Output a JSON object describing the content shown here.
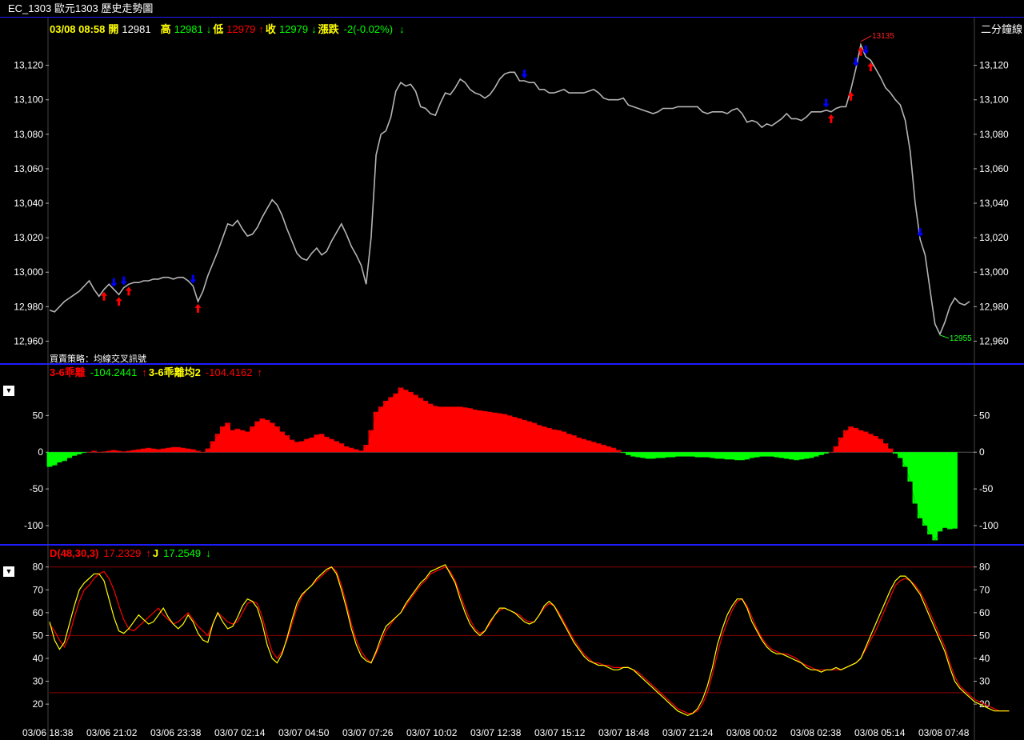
{
  "window": {
    "title": "EC_1303 歐元1303  歷史走勢圖"
  },
  "price_header": {
    "datetime": "03/08 08:58",
    "open_label": "開",
    "open": "12981",
    "high_label": "高",
    "high": "12981",
    "high_arrow": "↓",
    "low_label": "低",
    "low": "12979",
    "low_arrow": "↑",
    "close_label": "收",
    "close": "12979",
    "close_arrow": "↓",
    "change_label": "漲跌",
    "change": "-2(-0.02%)",
    "change_arrow": "↓",
    "period": "二分鐘線"
  },
  "strategy_label": "買賣策略：均線交叉訊號",
  "bias_header": {
    "name1": "3-6乖離",
    "value1": "-104.2441",
    "arrow1": "↑",
    "name2": "3-6乖離均2",
    "value2": "-104.4162",
    "arrow2": "↑"
  },
  "kd_header": {
    "name1": "D(48,30,3)",
    "value1": "17.2329",
    "arrow1": "↑",
    "name2": "J",
    "value2": "17.2549",
    "arrow2": "↓"
  },
  "panel_button": "▼",
  "colors": {
    "price_line": "#b4b4b4",
    "up": "#ff0000",
    "down": "#00ff00",
    "buy": "#ff0000",
    "sell": "#0000ff",
    "d_line": "#ff0000",
    "j_line": "#ffff00",
    "border": "#1c1cff",
    "label": "#ffff00"
  },
  "chart_data": [
    {
      "type": "line",
      "panel": "price",
      "ylim": [
        12950,
        13137
      ],
      "yticks": [
        12960,
        12980,
        13000,
        13020,
        13040,
        13060,
        13080,
        13100,
        13120
      ],
      "ytick_labels": [
        "12,960",
        "12,980",
        "13,000",
        "13,020",
        "13,040",
        "13,060",
        "13,080",
        "13,100",
        "13,120"
      ],
      "xlabels": [
        "03/06 18:38",
        "03/06 21:02",
        "03/06 23:38",
        "03/07 02:14",
        "03/07 04:50",
        "03/07 07:26",
        "03/07 10:02",
        "03/07 12:38",
        "03/07 15:12",
        "03/07 18:48",
        "03/07 21:24",
        "03/08 00:02",
        "03/08 02:38",
        "03/08 05:14",
        "03/08 07:48"
      ],
      "series": [
        {
          "values": [
            12978,
            12977,
            12980,
            12983,
            12985,
            12987,
            12989,
            12992,
            12995,
            12990,
            12986,
            12990,
            12993,
            12990,
            12987,
            12991,
            12993,
            12994,
            12994,
            12995,
            12995,
            12996,
            12996,
            12997,
            12997,
            12996,
            12997,
            12997,
            12995,
            12992,
            12983,
            12989,
            12998,
            13005,
            13012,
            13020,
            13028,
            13027,
            13030,
            13025,
            13021,
            13022,
            13026,
            13032,
            13037,
            13042,
            13039,
            13033,
            13025,
            13018,
            13011,
            13008,
            13007,
            13011,
            13014,
            13010,
            13012,
            13018,
            13023,
            13028,
            13022,
            13015,
            13010,
            13004,
            12993,
            13020,
            13068,
            13080,
            13082,
            13090,
            13105,
            13110,
            13108,
            13109,
            13105,
            13096,
            13095,
            13092,
            13091,
            13098,
            13104,
            13103,
            13107,
            13112,
            13110,
            13106,
            13104,
            13103,
            13101,
            13103,
            13107,
            13112,
            13115,
            13116,
            13116,
            13111,
            13111,
            13110,
            13110,
            13106,
            13106,
            13104,
            13104,
            13105,
            13106,
            13104,
            13104,
            13104,
            13104,
            13105,
            13106,
            13104,
            13101,
            13100,
            13100,
            13100,
            13101,
            13097,
            13096,
            13095,
            13094,
            13093,
            13092,
            13093,
            13095,
            13095,
            13095,
            13096,
            13096,
            13096,
            13096,
            13096,
            13093,
            13092,
            13093,
            13093,
            13093,
            13092,
            13094,
            13095,
            13092,
            13087,
            13088,
            13087,
            13084,
            13086,
            13085,
            13087,
            13089,
            13092,
            13089,
            13089,
            13088,
            13090,
            13093,
            13093,
            13093,
            13094,
            13093,
            13095,
            13096,
            13096,
            13106,
            13118,
            13132,
            13125,
            13123,
            13118,
            13113,
            13107,
            13104,
            13100,
            13097,
            13088,
            13070,
            13040,
            13019,
            13010,
            12990,
            12970,
            12964,
            12971,
            12980,
            12985,
            12982,
            12981,
            12983
          ]
        }
      ],
      "extremes": {
        "high": "13135",
        "low": "12955"
      },
      "signals": [
        {
          "i": 11,
          "type": "buy"
        },
        {
          "i": 13,
          "type": "sell"
        },
        {
          "i": 14,
          "type": "buy"
        },
        {
          "i": 15,
          "type": "sell"
        },
        {
          "i": 16,
          "type": "buy"
        },
        {
          "i": 29,
          "type": "sell"
        },
        {
          "i": 30,
          "type": "buy"
        },
        {
          "i": 96,
          "type": "sell"
        },
        {
          "i": 157,
          "type": "sell"
        },
        {
          "i": 158,
          "type": "buy"
        },
        {
          "i": 162,
          "type": "buy"
        },
        {
          "i": 163,
          "type": "sell"
        },
        {
          "i": 164,
          "type": "buy"
        },
        {
          "i": 165,
          "type": "sell"
        },
        {
          "i": 166,
          "type": "buy"
        },
        {
          "i": 176,
          "type": "sell"
        }
      ]
    },
    {
      "type": "bar",
      "panel": "bias",
      "ylim": [
        -125,
        95
      ],
      "yticks": [
        -100,
        -50,
        0,
        50
      ],
      "series": [
        {
          "name": "3-6乖離",
          "values": [
            -20,
            -18,
            -14,
            -12,
            -8,
            -5,
            -3,
            -1,
            0,
            2,
            0,
            1,
            2,
            3,
            2,
            1,
            2,
            3,
            4,
            5,
            6,
            5,
            4,
            5,
            6,
            7,
            7,
            6,
            5,
            4,
            2,
            0,
            5,
            15,
            25,
            35,
            40,
            30,
            32,
            30,
            28,
            35,
            42,
            46,
            44,
            40,
            35,
            28,
            23,
            17,
            14,
            15,
            18,
            20,
            24,
            25,
            21,
            18,
            15,
            12,
            8,
            6,
            4,
            2,
            10,
            30,
            55,
            62,
            70,
            75,
            80,
            88,
            85,
            82,
            78,
            74,
            70,
            66,
            63,
            62,
            62,
            62,
            62,
            62,
            61,
            60,
            58,
            57,
            56,
            55,
            54,
            53,
            52,
            50,
            48,
            46,
            44,
            42,
            40,
            37,
            35,
            33,
            31,
            30,
            28,
            25,
            23,
            20,
            18,
            16,
            14,
            12,
            10,
            8,
            6,
            3,
            -1,
            -4,
            -6,
            -7,
            -8,
            -9,
            -9,
            -8,
            -8,
            -7,
            -7,
            -6,
            -6,
            -6,
            -6,
            -7,
            -7,
            -7,
            -8,
            -9,
            -9,
            -10,
            -10,
            -11,
            -11,
            -10,
            -8,
            -7,
            -6,
            -6,
            -6,
            -7,
            -8,
            -9,
            -10,
            -11,
            -10,
            -9,
            -8,
            -6,
            -4,
            -2,
            0,
            8,
            20,
            30,
            35,
            33,
            30,
            28,
            25,
            22,
            18,
            12,
            5,
            -2,
            -8,
            -20,
            -40,
            -70,
            -90,
            -100,
            -112,
            -120,
            -108,
            -103,
            -105,
            -104
          ]
        }
      ]
    },
    {
      "type": "line",
      "panel": "kd",
      "ylim": [
        12,
        82
      ],
      "yticks": [
        20,
        30,
        40,
        50,
        60,
        70,
        80
      ],
      "refs": [
        25,
        50,
        80
      ],
      "series": [
        {
          "name": "D(48,30,3)",
          "values": [
            55,
            52,
            48,
            45,
            50,
            58,
            65,
            70,
            72,
            75,
            77,
            78,
            75,
            70,
            63,
            57,
            53,
            52,
            54,
            56,
            58,
            60,
            62,
            59,
            57,
            55,
            56,
            58,
            60,
            57,
            54,
            52,
            50,
            55,
            60,
            58,
            56,
            55,
            56,
            60,
            64,
            65,
            64,
            58,
            50,
            43,
            40,
            43,
            48,
            55,
            62,
            67,
            70,
            72,
            74,
            76,
            78,
            80,
            78,
            72,
            64,
            55,
            48,
            43,
            40,
            38,
            42,
            47,
            52,
            55,
            58,
            60,
            63,
            66,
            69,
            72,
            74,
            77,
            78,
            79,
            80,
            78,
            74,
            68,
            62,
            57,
            53,
            51,
            52,
            55,
            59,
            61,
            62,
            61,
            60,
            59,
            57,
            56,
            56,
            59,
            62,
            64,
            63,
            60,
            56,
            52,
            48,
            45,
            42,
            40,
            38,
            38,
            37,
            37,
            36,
            36,
            36,
            36,
            35,
            34,
            32,
            30,
            28,
            26,
            24,
            22,
            20,
            18,
            17,
            16,
            16,
            17,
            20,
            25,
            33,
            42,
            50,
            56,
            61,
            65,
            66,
            63,
            58,
            53,
            49,
            46,
            44,
            43,
            42,
            42,
            41,
            40,
            38,
            37,
            36,
            35,
            35,
            35,
            35,
            35,
            35,
            36,
            37,
            38,
            40,
            44,
            48,
            52,
            57,
            62,
            67,
            72,
            74,
            75,
            74,
            72,
            69,
            65,
            60,
            55,
            50,
            45,
            38,
            32,
            28,
            26,
            24,
            22,
            21,
            20,
            19,
            18,
            17,
            17,
            17
          ]
        },
        {
          "name": "J",
          "values": [
            56,
            48,
            44,
            47,
            55,
            63,
            70,
            73,
            75,
            77,
            77,
            74,
            66,
            58,
            52,
            51,
            53,
            56,
            59,
            57,
            55,
            56,
            59,
            62,
            58,
            55,
            53,
            55,
            59,
            56,
            51,
            48,
            47,
            55,
            60,
            56,
            53,
            54,
            58,
            63,
            66,
            65,
            62,
            55,
            46,
            40,
            38,
            42,
            49,
            57,
            64,
            68,
            70,
            72,
            75,
            77,
            79,
            80,
            77,
            70,
            62,
            53,
            46,
            41,
            39,
            38,
            43,
            49,
            54,
            56,
            58,
            60,
            64,
            67,
            70,
            73,
            75,
            78,
            79,
            80,
            81,
            77,
            73,
            66,
            60,
            55,
            52,
            50,
            52,
            56,
            59,
            62,
            62,
            61,
            60,
            58,
            56,
            55,
            56,
            59,
            63,
            65,
            63,
            59,
            55,
            51,
            47,
            44,
            41,
            39,
            38,
            37,
            37,
            36,
            35,
            35,
            36,
            36,
            35,
            33,
            31,
            29,
            27,
            25,
            23,
            21,
            19,
            17,
            16,
            15,
            16,
            18,
            22,
            28,
            36,
            46,
            53,
            59,
            63,
            66,
            66,
            62,
            56,
            52,
            48,
            45,
            43,
            42,
            42,
            41,
            40,
            39,
            38,
            36,
            35,
            35,
            34,
            35,
            35,
            36,
            35,
            36,
            37,
            38,
            40,
            45,
            50,
            55,
            60,
            65,
            70,
            74,
            76,
            76,
            74,
            71,
            68,
            63,
            58,
            53,
            48,
            43,
            36,
            30,
            27,
            25,
            23,
            21,
            20,
            19,
            18,
            17,
            17,
            17,
            17
          ]
        }
      ]
    }
  ]
}
